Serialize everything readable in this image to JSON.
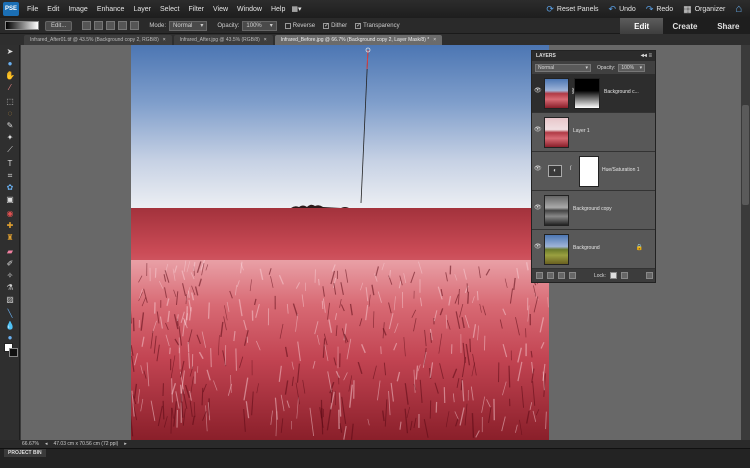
{
  "app": {
    "logo": "PSE"
  },
  "menu": [
    "File",
    "Edit",
    "Image",
    "Enhance",
    "Layer",
    "Select",
    "Filter",
    "View",
    "Window",
    "Help"
  ],
  "top_actions": [
    {
      "label": "Reset Panels",
      "icon": "reset-icon",
      "glyph": "⟳"
    },
    {
      "label": "Undo",
      "icon": "undo-icon",
      "glyph": "↶"
    },
    {
      "label": "Redo",
      "icon": "redo-icon",
      "glyph": "↷"
    },
    {
      "label": "Organizer",
      "icon": "organizer-icon",
      "glyph": "▦"
    }
  ],
  "mode_tabs": [
    "Edit",
    "Create",
    "Share"
  ],
  "options": {
    "edit_label": "Edit...",
    "mode_label": "Mode:",
    "mode_value": "Normal",
    "opacity_label": "Opacity:",
    "opacity_value": "100%",
    "reverse_label": "Reverse",
    "dither_label": "Dither",
    "transparency_label": "Transparency"
  },
  "doc_tabs": [
    {
      "label": "Infrared_After01.tif @ 43.5% (Background copy 2, RGB/8)",
      "active": false
    },
    {
      "label": "Infrared_After.jpg @ 43.5% (RGB/8)",
      "active": false
    },
    {
      "label": "Infrared_Before.jpg @ 66.7% (Background copy 2, Layer Mask/8) *",
      "active": true
    }
  ],
  "layers_panel": {
    "title": "LAYERS",
    "blend_mode": "Normal",
    "opacity_label": "Opacity:",
    "opacity_value": "100%",
    "lock_label": "Lock:",
    "layers": [
      {
        "name": "Background c...",
        "selected": true
      },
      {
        "name": "Layer 1",
        "selected": false
      },
      {
        "name": "Hue/Saturation 1",
        "selected": false
      },
      {
        "name": "Background copy",
        "selected": false
      },
      {
        "name": "Background",
        "selected": false
      }
    ]
  },
  "status": {
    "zoom": "66.67%",
    "doc_info": "47.03 cm x 70.56 cm (72 ppi)"
  },
  "project_bin": {
    "label": "PROJECT BIN"
  },
  "colors": {
    "accent": "#1b6fb5",
    "sky_top": "#4c76b3",
    "field_red": "#c24452"
  }
}
